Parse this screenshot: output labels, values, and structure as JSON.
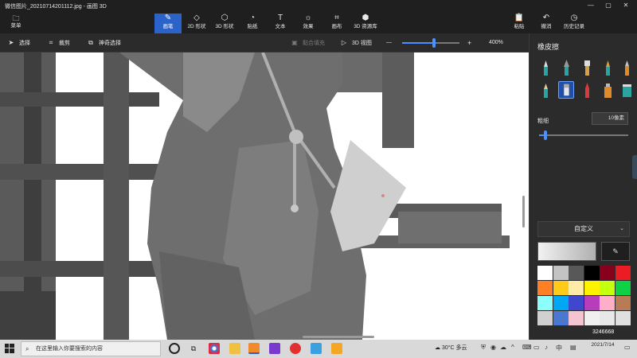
{
  "window": {
    "title": "微信图片_20210714201112.jpg - 画图 3D",
    "controls": [
      "—",
      "▢",
      "✕"
    ]
  },
  "ribbon": {
    "menu_label": "菜单",
    "tools": [
      {
        "label": "画笔",
        "icon": "brush-icon",
        "glyph": "✎",
        "active": true
      },
      {
        "label": "2D 形状",
        "icon": "shapes-2d-icon",
        "glyph": "◇",
        "active": false
      },
      {
        "label": "3D 形状",
        "icon": "cube-icon",
        "glyph": "⬡",
        "active": false
      },
      {
        "label": "贴纸",
        "icon": "sticker-icon",
        "glyph": "◔",
        "active": false
      },
      {
        "label": "文本",
        "icon": "text-icon",
        "glyph": "T",
        "active": false
      },
      {
        "label": "效果",
        "icon": "effects-icon",
        "glyph": "☼",
        "active": false
      },
      {
        "label": "画布",
        "icon": "canvas-icon",
        "glyph": "⌗",
        "active": false
      },
      {
        "label": "3D 资源库",
        "icon": "library-3d-icon",
        "glyph": "⬢",
        "active": false
      }
    ],
    "right_tools": [
      {
        "label": "粘贴",
        "icon": "paste-icon",
        "glyph": "📋"
      },
      {
        "label": "撤消",
        "icon": "undo-icon",
        "glyph": "↶"
      },
      {
        "label": "历史记录",
        "icon": "history-icon",
        "glyph": "◷"
      }
    ]
  },
  "toolbar2": {
    "select_label": "选择",
    "crop_label": "裁剪",
    "magic_select_label": "神奇选择",
    "texture_label": "黏合填充",
    "view3d_label": "3D 视图",
    "zoom_minus": "—",
    "zoom_plus": "+",
    "zoom_percent": "400%",
    "zoom_fraction": 0.55
  },
  "panel": {
    "title": "橡皮擦",
    "thickness_label": "粗细",
    "thickness_value": "10像素",
    "thickness_fraction": 0.05,
    "dropdown_label": "自定义",
    "colors": {
      "accent": "#2a63c9",
      "current_color_gradient": [
        "#f2f2f2",
        "#b0b0b0"
      ]
    },
    "palette": [
      "#ffffff",
      "#c3c3c3",
      "#585858",
      "#000000",
      "#88001b",
      "#ec1c24",
      "#ff7f27",
      "#ffca18",
      "#fdeca6",
      "#fff200",
      "#c4ff0e",
      "#0ed145",
      "#8cfffb",
      "#00a8f3",
      "#3f48cc",
      "#b83dba",
      "#ffaec8",
      "#b97a56",
      "#d0d0d0",
      "#4a78d0",
      "#f4c5d0",
      "#f0f0f0",
      "#e8e8e8",
      "#e0e0e0"
    ]
  },
  "taskbar": {
    "search_placeholder": "在这里输入你要搜索的内容",
    "weather": "30°C 多云",
    "time": "2021/7/14",
    "watermark": "3246668"
  }
}
